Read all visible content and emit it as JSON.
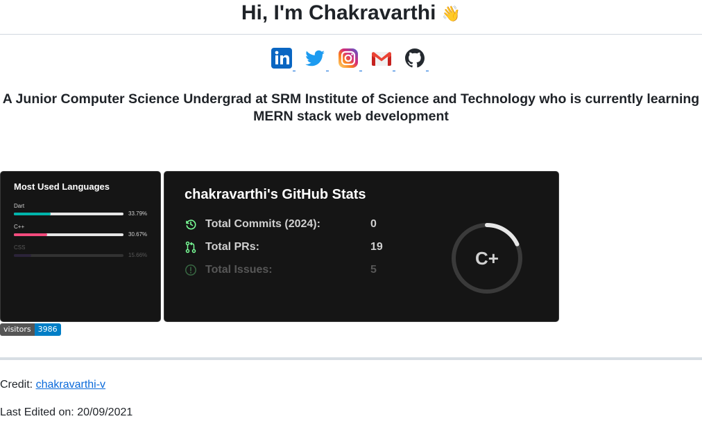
{
  "header": {
    "title": "Hi, I'm Chakravarthi",
    "emoji": "👋"
  },
  "socials": [
    {
      "name": "linkedin",
      "icon": "linkedin-icon",
      "color": "#0a66c2"
    },
    {
      "name": "twitter",
      "icon": "twitter-icon",
      "color": "#1d9bf0"
    },
    {
      "name": "instagram",
      "icon": "instagram-icon",
      "color": "#e1306c"
    },
    {
      "name": "gmail",
      "icon": "gmail-icon",
      "color": "#ea4335"
    },
    {
      "name": "github",
      "icon": "github-icon",
      "color": "#24292f"
    }
  ],
  "tagline": "A Junior Computer Science Undergrad at SRM Institute of Science and Technology who is currently learning MERN stack web development",
  "languages_card": {
    "title": "Most Used Languages",
    "items": [
      {
        "name": "Dart",
        "percent": "33.79%",
        "value": 33.79,
        "color": "#00B4AB"
      },
      {
        "name": "C++",
        "percent": "30.67%",
        "value": 30.67,
        "color": "#f34b7d"
      },
      {
        "name": "CSS",
        "percent": "15.66%",
        "value": 15.66,
        "color": "#563d7c"
      }
    ]
  },
  "stats_card": {
    "title": "chakravarthi's GitHub Stats",
    "rows": [
      {
        "label": "Total Commits (2024):",
        "value": "0",
        "icon": "history-icon"
      },
      {
        "label": "Total PRs:",
        "value": "19",
        "icon": "pull-request-icon"
      },
      {
        "label": "Total Issues:",
        "value": "5",
        "icon": "issue-icon"
      }
    ],
    "grade": "C+",
    "grade_progress": 0.18,
    "accent": "#79ff97"
  },
  "visitors_badge": {
    "label": "visitors",
    "count": "3986"
  },
  "footer": {
    "credit_label": "Credit: ",
    "credit_link": "chakravarthi-v",
    "last_edited": "Last Edited on: 20/09/2021"
  }
}
